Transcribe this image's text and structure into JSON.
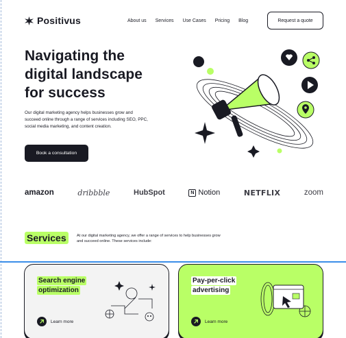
{
  "header": {
    "logo_text": "Positivus",
    "nav": [
      "About us",
      "Services",
      "Use Cases",
      "Pricing",
      "Blog"
    ],
    "cta": "Request a quote"
  },
  "hero": {
    "title_lines": [
      "Navigating the",
      "digital landscape",
      "for success"
    ],
    "description": "Our digital marketing agency helps businesses grow and succeed online through a range of services including SEO, PPC, social media marketing, and content creation.",
    "button": "Book a consultation"
  },
  "brands": [
    "amazon",
    "dribbble",
    "HubSpot",
    "Notion",
    "NETFLIX",
    "zoom"
  ],
  "services": {
    "heading": "Services",
    "description": "At our digital marketing agency, we offer a range of services to help businesses grow and succeed online. These services include:",
    "cards": [
      {
        "title_lines": [
          "Search engine",
          "optimization"
        ],
        "link": "Learn more",
        "icon": "seo-illustration"
      },
      {
        "title_lines": [
          "Pay-per-click",
          "advertising"
        ],
        "link": "Learn more",
        "icon": "ppc-illustration"
      }
    ]
  },
  "colors": {
    "accent": "#B9FF66",
    "dark": "#191A23",
    "grey": "#F3F3F3"
  }
}
